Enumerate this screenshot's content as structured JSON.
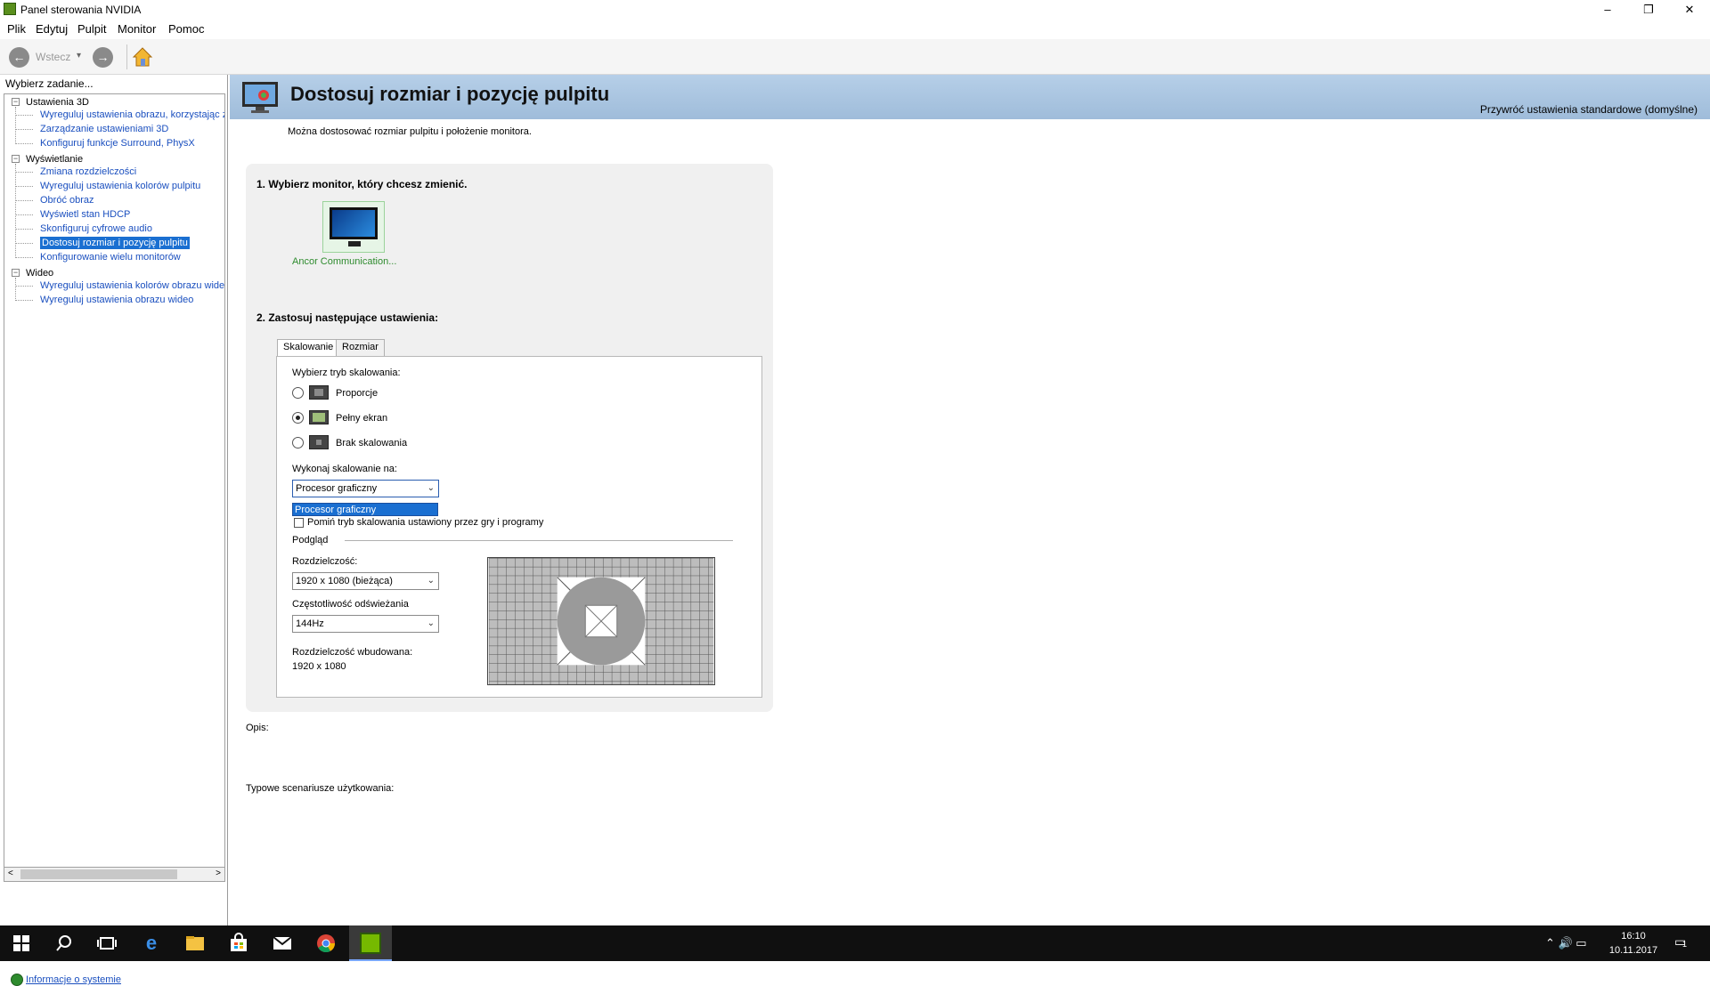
{
  "window": {
    "title": "Panel sterowania NVIDIA",
    "controls": {
      "minimize": "–",
      "restore": "❐",
      "close": "✕"
    }
  },
  "menu": [
    "Plik",
    "Edytuj",
    "Pulpit",
    "Monitor",
    "Pomoc"
  ],
  "toolbar": {
    "back_label": "Wstecz",
    "back_dropdown": "▾",
    "back_icon": "arrow-left-icon",
    "forward_icon": "arrow-right-icon",
    "home_icon": "home-icon"
  },
  "sidebar": {
    "task_label": "Wybierz zadanie...",
    "tree": [
      {
        "label": "Ustawienia 3D",
        "type": "group",
        "expander": "−",
        "children": [
          {
            "label": "Wyreguluj ustawienia obrazu, korzystając z"
          },
          {
            "label": "Zarządzanie ustawieniami 3D"
          },
          {
            "label": "Konfiguruj funkcje Surround, PhysX"
          }
        ]
      },
      {
        "label": "Wyświetlanie",
        "type": "group",
        "expander": "−",
        "children": [
          {
            "label": "Zmiana rozdzielczości"
          },
          {
            "label": "Wyreguluj ustawienia kolorów pulpitu"
          },
          {
            "label": "Obróć obraz"
          },
          {
            "label": "Wyświetl stan HDCP"
          },
          {
            "label": "Skonfiguruj cyfrowe audio"
          },
          {
            "label": "Dostosuj rozmiar i pozycję pulpitu",
            "selected": true
          },
          {
            "label": "Konfigurowanie wielu monitorów"
          }
        ]
      },
      {
        "label": "Wideo",
        "type": "group",
        "expander": "−",
        "children": [
          {
            "label": "Wyreguluj ustawienia kolorów obrazu wideo"
          },
          {
            "label": "Wyreguluj ustawienia obrazu wideo"
          }
        ]
      }
    ],
    "scroll": {
      "left_arrow": "<",
      "right_arrow": ">"
    },
    "system_info_link": "Informacje o systemie"
  },
  "content": {
    "title": "Dostosuj rozmiar i pozycję pulpitu",
    "restore_defaults": "Przywróć ustawienia standardowe (domyślne)",
    "intro": "Można dostosować rozmiar pulpitu i położenie monitora.",
    "step1": "1. Wybierz monitor, który chcesz zmienić.",
    "monitor_label": "Ancor Communication...",
    "step2": "2. Zastosuj następujące ustawienia:",
    "tabs": [
      "Skalowanie",
      "Rozmiar"
    ],
    "active_tab": "Skalowanie",
    "scaling": {
      "mode_label": "Wybierz tryb skalowania:",
      "options": [
        {
          "label": "Proporcje",
          "selected": false
        },
        {
          "label": "Pełny ekran",
          "selected": true
        },
        {
          "label": "Brak skalowania",
          "selected": false
        }
      ],
      "perform_on_label": "Wykonaj skalowanie na:",
      "perform_on_value": "Procesor graficzny",
      "dropdown_open_item": "Procesor graficzny",
      "override_text": "Pomiń tryb skalowania ustawiony przez gry i programy",
      "override_checked": false
    },
    "preview": {
      "label": "Podgląd",
      "resolution_label": "Rozdzielczość:",
      "resolution_value": "1920 x 1080 (bieżąca)",
      "refresh_label": "Częstotliwość odświeżania",
      "refresh_value": "144Hz",
      "native_label": "Rozdzielczość wbudowana:",
      "native_value": "1920 x 1080"
    },
    "description_label": "Opis:",
    "scenarios_label": "Typowe scenariusze użytkowania:"
  },
  "taskbar": {
    "icons": [
      "windows-start-icon",
      "search-icon",
      "task-view-icon",
      "edge-icon",
      "file-explorer-icon",
      "store-icon",
      "mail-icon",
      "chrome-icon",
      "nvidia-icon"
    ],
    "tray": "⌃  🔊  ▭",
    "time": "16:10",
    "date": "10.11.2017",
    "notifications_icon": "notifications-icon",
    "notification_count": "1"
  }
}
